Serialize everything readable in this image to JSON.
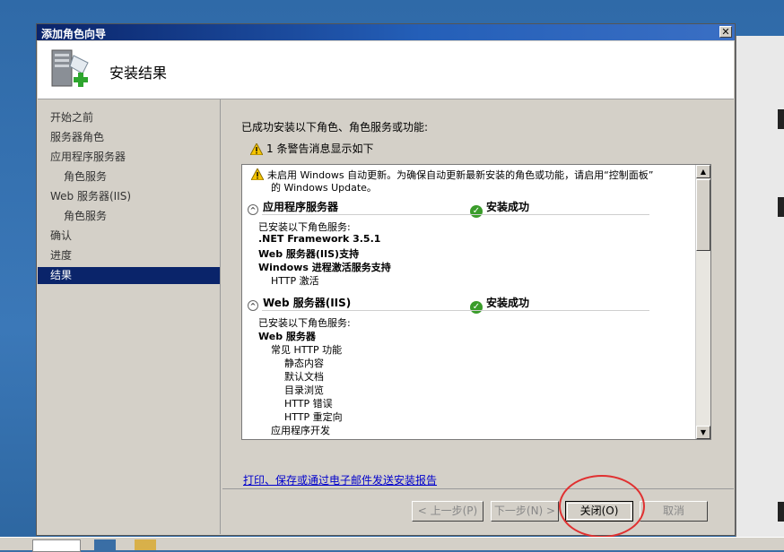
{
  "window": {
    "title": "添加角色向导",
    "close_glyph": "✕"
  },
  "header": {
    "title": "安装结果",
    "icon": "server-add-icon"
  },
  "sidebar": {
    "items": [
      {
        "label": "开始之前",
        "sub": false,
        "active": false
      },
      {
        "label": "服务器角色",
        "sub": false,
        "active": false
      },
      {
        "label": "应用程序服务器",
        "sub": false,
        "active": false
      },
      {
        "label": "角色服务",
        "sub": true,
        "active": false
      },
      {
        "label": "Web 服务器(IIS)",
        "sub": false,
        "active": false
      },
      {
        "label": "角色服务",
        "sub": true,
        "active": false
      },
      {
        "label": "确认",
        "sub": false,
        "active": false
      },
      {
        "label": "进度",
        "sub": false,
        "active": false
      },
      {
        "label": "结果",
        "sub": false,
        "active": true
      }
    ]
  },
  "content": {
    "intro": "已成功安装以下角色、角色服务或功能:",
    "warning_summary": "1 条警告消息显示如下",
    "update_warning_line1": "未启用 Windows 自动更新。为确保自动更新最新安装的角色或功能，请启用“控制面板”",
    "update_warning_line2": "的 Windows Update。",
    "section1": {
      "title": "应用程序服务器",
      "status": "安装成功",
      "installed_label": "已安装以下角色服务:",
      "items": [
        ".NET Framework 3.5.1",
        "Web 服务器(IIS)支持",
        "Windows 进程激活服务支持",
        "HTTP 激活"
      ]
    },
    "section2": {
      "title": "Web 服务器(IIS)",
      "status": "安装成功",
      "installed_label": "已安装以下角色服务:",
      "items": [
        "Web 服务器",
        "常见 HTTP 功能",
        "静态内容",
        "默认文档",
        "目录浏览",
        "HTTP 错误",
        "HTTP 重定向",
        "应用程序开发"
      ]
    },
    "report_link": "打印、保存或通过电子邮件发送安装报告"
  },
  "buttons": {
    "prev": "< 上一步(P)",
    "next": "下一步(N) >",
    "close": "关闭(O)",
    "cancel": "取消"
  },
  "colors": {
    "title_bar": "#0a246a",
    "selected_nav": "#0a246a",
    "link": "#0000cc",
    "annotation": "#e03030"
  }
}
